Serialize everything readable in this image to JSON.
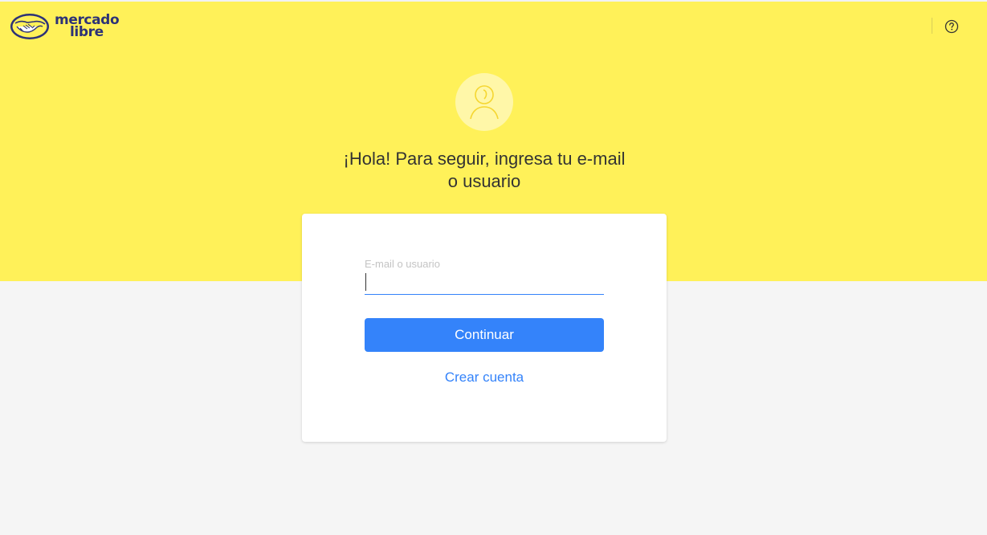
{
  "header": {
    "logo": {
      "line1": "mercado",
      "line2": "libre",
      "icon": "handshake-icon"
    },
    "help_icon": "question-circle-icon"
  },
  "main": {
    "avatar_icon": "user-icon",
    "heading_line1": "¡Hola! Para seguir, ingresa tu e-mail",
    "heading_line2": "o usuario"
  },
  "login_form": {
    "email_label": "E-mail o usuario",
    "email_value": "",
    "continue_label": "Continuar",
    "create_account_label": "Crear cuenta"
  },
  "colors": {
    "brand_yellow": "#fff159",
    "brand_blue": "#3483fa",
    "logo_navy": "#2d3277",
    "page_background": "#f5f5f5"
  }
}
